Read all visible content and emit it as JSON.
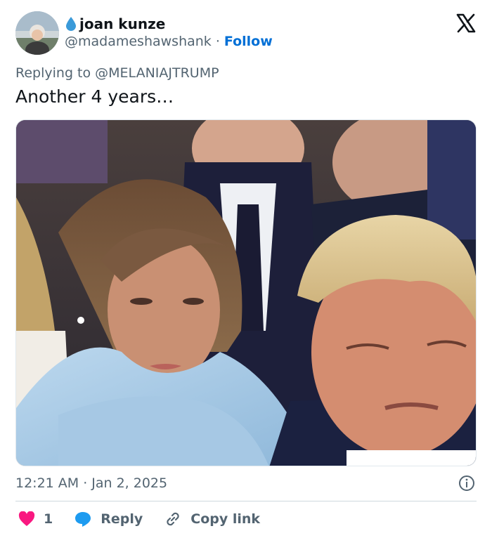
{
  "tweet": {
    "author": {
      "display_name": "joan kunze",
      "handle": "@madameshawshank",
      "separator": "·",
      "follow_label": "Follow"
    },
    "replying_to": "Replying to @MELANIAJTRUMP",
    "text": "Another 4 years…",
    "time": "12:21 AM",
    "date_separator": "·",
    "date": "Jan 2, 2025"
  },
  "actions": {
    "like_count": "1",
    "reply_label": "Reply",
    "copy_link_label": "Copy link"
  },
  "colors": {
    "like": "#f91880",
    "reply": "#1d9bf0",
    "follow": "#006fd6",
    "secondary_text": "#536471"
  },
  "icons": [
    "water-drop-icon",
    "x-logo-icon",
    "info-icon",
    "heart-icon",
    "reply-bubble-icon",
    "link-icon"
  ]
}
